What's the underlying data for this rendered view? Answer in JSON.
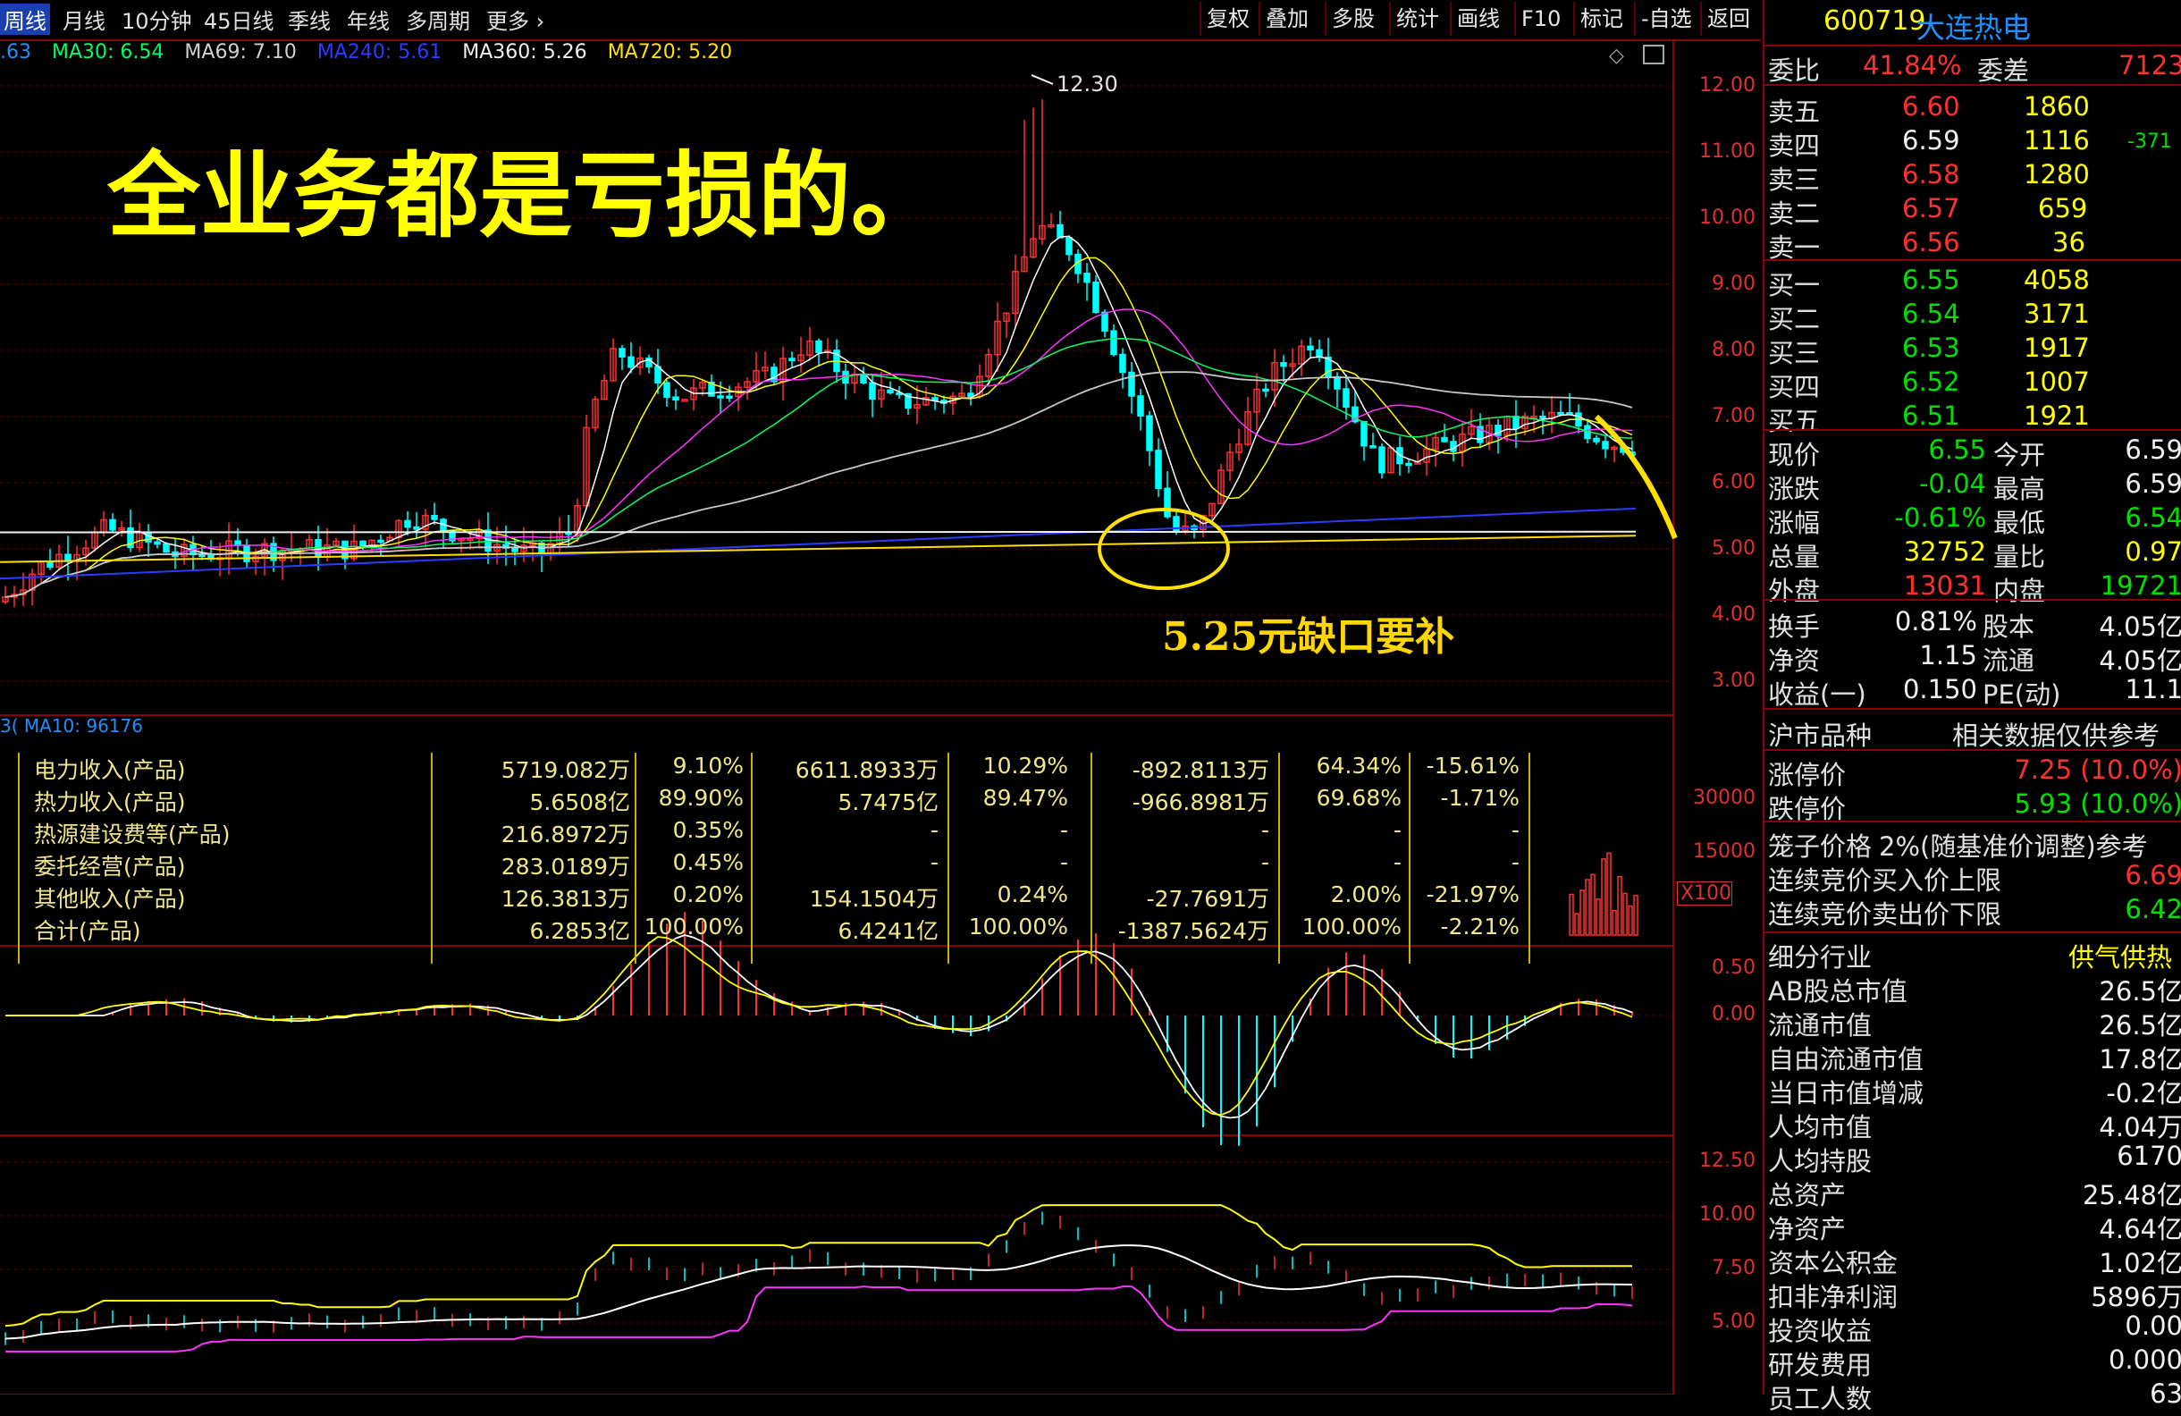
{
  "toolbar": {
    "tabs": [
      "周线",
      "月线",
      "10分钟",
      "45日线",
      "季线",
      "年线",
      "多周期",
      "更多"
    ],
    "buttons": [
      "复权",
      "叠加",
      "多股",
      "统计",
      "画线",
      "F10",
      "标记",
      "-自选",
      "返回"
    ]
  },
  "stock": {
    "code": "600719",
    "name": "大连热电"
  },
  "ma_legend": [
    {
      "text": ".63",
      "color": "#1e90ff"
    },
    {
      "text": "MA30: 6.54",
      "color": "#00ff66"
    },
    {
      "text": "MA69: 7.10",
      "color": "#d0d0d0"
    },
    {
      "text": "MA240: 5.61",
      "color": "#2a3cff"
    },
    {
      "text": "MA360: 5.26",
      "color": "#f0f0f0"
    },
    {
      "text": "MA720: 5.20",
      "color": "#ffe000"
    }
  ],
  "annotations": {
    "headline": "全业务都是亏损的。",
    "gap_note": "5.25元缺口要补",
    "high_label": "12.30"
  },
  "price_axis": [
    "12.00",
    "11.00",
    "10.00",
    "9.00",
    "8.00",
    "7.00",
    "6.00",
    "5.00",
    "4.00",
    "3.00"
  ],
  "volume_axis": [
    "30000",
    "15000",
    "X100"
  ],
  "macd_axis": [
    "0.50",
    "0.00"
  ],
  "bottom_axis": [
    "12.50",
    "10.00",
    "7.50",
    "5.00"
  ],
  "volume_legend": "3(  MA10: 96176",
  "revenue_table": [
    [
      "电力收入(产品)",
      "5719.082万",
      "9.10%",
      "6611.8933万",
      "10.29%",
      "-892.8113万",
      "64.34%",
      "-15.61%"
    ],
    [
      "热力收入(产品)",
      "5.6508亿",
      "89.90%",
      "5.7475亿",
      "89.47%",
      "-966.8981万",
      "69.68%",
      "-1.71%"
    ],
    [
      "热源建设费等(产品)",
      "216.8972万",
      "0.35%",
      "-",
      "-",
      "-",
      "-",
      "-"
    ],
    [
      "委托经营(产品)",
      "283.0189万",
      "0.45%",
      "-",
      "-",
      "-",
      "-",
      "-"
    ],
    [
      "其他收入(产品)",
      "126.3813万",
      "0.20%",
      "154.1504万",
      "0.24%",
      "-27.7691万",
      "2.00%",
      "-21.97%"
    ],
    [
      "合计(产品)",
      "6.2853亿",
      "100.00%",
      "6.4241亿",
      "100.00%",
      "-1387.5624万",
      "100.00%",
      "-2.21%"
    ]
  ],
  "panel": {
    "wei": {
      "label1": "委比",
      "v1": "41.84%",
      "label2": "委差",
      "v2": "7123"
    },
    "asks": [
      {
        "label": "卖五",
        "price": "6.60",
        "vol": "1860",
        "chg": ""
      },
      {
        "label": "卖四",
        "price": "6.59",
        "vol": "1116",
        "chg": "-371"
      },
      {
        "label": "卖三",
        "price": "6.58",
        "vol": "1280",
        "chg": ""
      },
      {
        "label": "卖二",
        "price": "6.57",
        "vol": "659",
        "chg": ""
      },
      {
        "label": "卖一",
        "price": "6.56",
        "vol": "36",
        "chg": ""
      }
    ],
    "bids": [
      {
        "label": "买一",
        "price": "6.55",
        "vol": "4058"
      },
      {
        "label": "买二",
        "price": "6.54",
        "vol": "3171"
      },
      {
        "label": "买三",
        "price": "6.53",
        "vol": "1917"
      },
      {
        "label": "买四",
        "price": "6.52",
        "vol": "1007"
      },
      {
        "label": "买五",
        "price": "6.51",
        "vol": "1921"
      }
    ],
    "quote": [
      {
        "l1": "现价",
        "v1": "6.55",
        "c1": "#00e000",
        "l2": "今开",
        "v2": "6.59",
        "c2": "#f0f0f0"
      },
      {
        "l1": "涨跌",
        "v1": "-0.04",
        "c1": "#00e000",
        "l2": "最高",
        "v2": "6.59",
        "c2": "#f0f0f0"
      },
      {
        "l1": "涨幅",
        "v1": "-0.61%",
        "c1": "#00e000",
        "l2": "最低",
        "v2": "6.54",
        "c2": "#00e000"
      },
      {
        "l1": "总量",
        "v1": "32752",
        "c1": "#ffff00",
        "l2": "量比",
        "v2": "0.97",
        "c2": "#ffff00"
      },
      {
        "l1": "外盘",
        "v1": "13031",
        "c1": "#ff3030",
        "l2": "内盘",
        "v2": "19721",
        "c2": "#00e000"
      }
    ],
    "fund": [
      {
        "l1": "换手",
        "v1": "0.81%",
        "l2": "股本",
        "v2": "4.05亿"
      },
      {
        "l1": "净资",
        "v1": "1.15",
        "l2": "流通",
        "v2": "4.05亿"
      },
      {
        "l1": "收益(一)",
        "v1": "0.150",
        "l2": "PE(动)",
        "v2": "11.1"
      }
    ],
    "market_row": {
      "label": "沪市品种",
      "note": "相关数据仅供参考"
    },
    "limits": [
      {
        "label": "涨停价",
        "value": "7.25 (10.0%)",
        "color": "#ff3030"
      },
      {
        "label": "跌停价",
        "value": "5.93 (10.0%)",
        "color": "#00e000"
      }
    ],
    "cage": {
      "label": "笼子价格",
      "note": "2%(随基准价调整)参考"
    },
    "auction": [
      {
        "label": "连续竞价买入价上限",
        "value": "6.69",
        "color": "#ff3030"
      },
      {
        "label": "连续竞价卖出价下限",
        "value": "6.42",
        "color": "#00e000"
      }
    ],
    "industry": {
      "label": "细分行业",
      "value": "供气供热"
    },
    "stats": [
      {
        "label": "AB股总市值",
        "value": "26.5亿"
      },
      {
        "label": "流通市值",
        "value": "26.5亿"
      },
      {
        "label": "自由流通市值",
        "value": "17.8亿"
      },
      {
        "label": "当日市值增减",
        "value": "-0.2亿"
      },
      {
        "label": "人均市值",
        "value": "4.04万"
      },
      {
        "label": "人均持股",
        "value": "6170"
      },
      {
        "label": "总资产",
        "value": "25.48亿"
      },
      {
        "label": "净资产",
        "value": "4.64亿"
      },
      {
        "label": "资本公积金",
        "value": "1.02亿"
      },
      {
        "label": "扣非净利润",
        "value": "5896万"
      },
      {
        "label": "投资收益",
        "value": "0.00"
      },
      {
        "label": "研发费用",
        "value": "0.000"
      },
      {
        "label": "员工人数",
        "value": "63"
      }
    ]
  },
  "colors": {
    "up": "#ff3030",
    "down": "#00ffff",
    "grid": "#8b0000",
    "accent": "#ffff00"
  }
}
